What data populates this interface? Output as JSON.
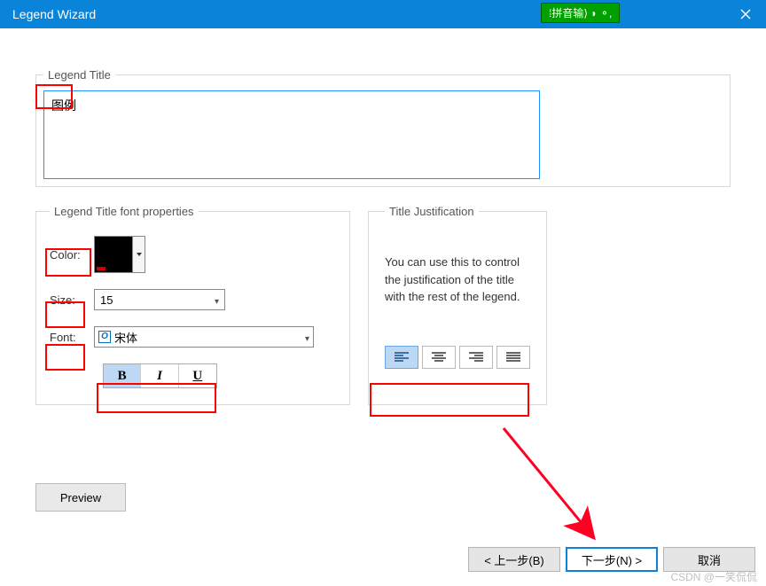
{
  "window": {
    "title": "Legend Wizard",
    "ime": "⁞拼音输⟩ ◗ ⚬,"
  },
  "legendTitle": {
    "legend": "Legend Title",
    "value": "图例"
  },
  "fontProps": {
    "legend": "Legend Title font properties",
    "colorLabel": "Color:",
    "sizeLabel": "Size:",
    "sizeValue": "15",
    "fontLabel": "Font:",
    "fontValue": "宋体",
    "bold": "B",
    "italic": "I",
    "underline": "U"
  },
  "justify": {
    "legend": "Title Justification",
    "desc": "You can use this to control the justification of the title with the rest of the legend."
  },
  "buttons": {
    "preview": "Preview",
    "back": "< 上一步(B)",
    "next": "下一步(N) >",
    "cancel": "取消"
  },
  "watermark": "CSDN @一笑侃侃"
}
